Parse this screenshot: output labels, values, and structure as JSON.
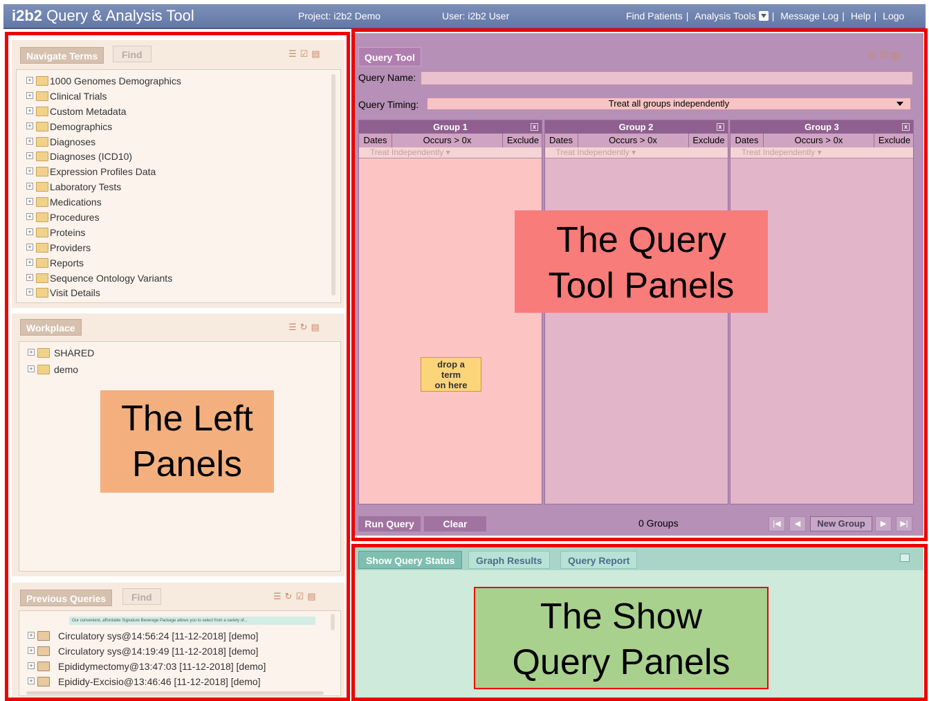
{
  "header": {
    "brand_bold": "i2b2",
    "brand_rest": "Query & Analysis Tool",
    "project": "Project: i2b2 Demo",
    "user": "User: i2b2 User",
    "nav": [
      "Find Patients",
      "Analysis Tools",
      "Message Log",
      "Help",
      "Logo"
    ]
  },
  "navigate": {
    "tabs": [
      "Navigate Terms",
      "Find"
    ],
    "items": [
      "1000 Genomes Demographics",
      "Clinical Trials",
      "Custom Metadata",
      "Demographics",
      "Diagnoses",
      "Diagnoses (ICD10)",
      "Expression Profiles Data",
      "Laboratory Tests",
      "Medications",
      "Procedures",
      "Proteins",
      "Providers",
      "Reports",
      "Sequence Ontology Variants",
      "Visit Details"
    ]
  },
  "workplace": {
    "tab": "Workplace",
    "items": [
      "SHARED",
      "demo"
    ]
  },
  "previous": {
    "tabs": [
      "Previous Queries",
      "Find"
    ],
    "tooltip": "Our convenient, affordable Signature Beverage Package allows you to select from a variety of...",
    "items": [
      "Circulatory sys@14:56:24 [11-12-2018] [demo]",
      "Circulatory sys@14:19:49 [11-12-2018] [demo]",
      "Epididymectomy@13:47:03 [11-12-2018] [demo]",
      "Epididy-Excisio@13:46:46 [11-12-2018] [demo]"
    ]
  },
  "query_tool": {
    "tab": "Query Tool",
    "name_label": "Query Name:",
    "timing_label": "Query Timing:",
    "timing_value": "Treat all groups independently",
    "groups": [
      {
        "title": "Group 1",
        "dates": "Dates",
        "occurs": "Occurs > 0x",
        "exclude": "Exclude",
        "treat": "Treat Independently",
        "color": "#fdc4c4"
      },
      {
        "title": "Group 2",
        "dates": "Dates",
        "occurs": "Occurs > 0x",
        "exclude": "Exclude",
        "treat": "Treat Independently",
        "color": "#e2b5c9"
      },
      {
        "title": "Group 3",
        "dates": "Dates",
        "occurs": "Occurs > 0x",
        "exclude": "Exclude",
        "treat": "Treat Independently",
        "color": "#e2b5c9"
      }
    ],
    "drop_text": [
      "drop a",
      "term",
      "on here"
    ],
    "run_label": "Run Query",
    "clear_label": "Clear",
    "groups_count": "0 Groups",
    "new_group_label": "New Group"
  },
  "show_query": {
    "tabs": [
      "Show Query Status",
      "Graph Results",
      "Query Report"
    ]
  },
  "annotations": {
    "query_tool": [
      "The Query",
      "Tool Panels"
    ],
    "left": [
      "The Left",
      "Panels"
    ],
    "show_query": [
      "The Show",
      "Query Panels"
    ]
  },
  "colors": {
    "annot_query": "#f87c7a",
    "annot_left": "#f3b07e",
    "annot_show": "#a9d18e",
    "outline": "#ee0000"
  }
}
